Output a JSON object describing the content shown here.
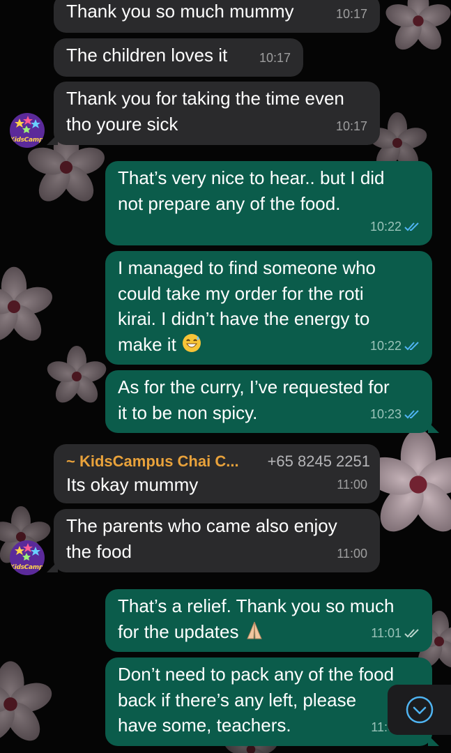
{
  "contact": {
    "avatar_label": "KidsCampus"
  },
  "messages": [
    {
      "direction": "in",
      "text": "Thank you so much mummy",
      "time": "10:17"
    },
    {
      "direction": "in",
      "text": "The children loves it",
      "time": "10:17"
    },
    {
      "direction": "in",
      "text": "Thank you for taking the time even\ntho youre sick",
      "time": "10:17"
    },
    {
      "direction": "out",
      "text": "That’s very nice to hear.. but I did\nnot prepare any of the food.",
      "time": "10:22",
      "status": "read"
    },
    {
      "direction": "out",
      "text": "I managed to find someone who\ncould take my order for the roti\nkirai. I didn’t have the energy to\nmake it",
      "emoji": "grinning-face-with-sweat",
      "time": "10:22",
      "status": "read"
    },
    {
      "direction": "out",
      "text": "As for the curry, I’ve requested for\nit to be non spicy.",
      "time": "10:23",
      "status": "read"
    },
    {
      "direction": "in",
      "sender": "~ KidsCampus Chai C...",
      "sender_phone": "+65 8245 2251",
      "text": "Its okay mummy",
      "time": "11:00"
    },
    {
      "direction": "in",
      "text": "The parents who came also enjoy\nthe food",
      "time": "11:00"
    },
    {
      "direction": "out",
      "text": "That’s a relief. Thank you so much\nfor the updates",
      "emoji": "folded-hands",
      "time": "11:01",
      "status": "delivered"
    },
    {
      "direction": "out",
      "text": "Don’t need to pack any of the food\nback if there’s any left, please\nhave some, teachers.",
      "time": "11:02",
      "status": "delivered"
    }
  ],
  "colors": {
    "incoming_bubble": "#2a2a2c",
    "outgoing_bubble": "#0b5c4b",
    "read_ticks": "#4fb4f2",
    "sender_name": "#e9a23b",
    "background": "#050505"
  },
  "scroll_button": {
    "icon": "chevron-down-icon"
  }
}
